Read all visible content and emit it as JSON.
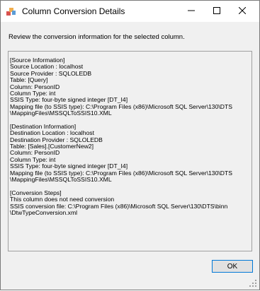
{
  "window": {
    "title": "Column Conversion Details",
    "controls": {
      "minimize_icon": "minimize-icon",
      "maximize_icon": "maximize-icon",
      "close_icon": "close-icon"
    }
  },
  "instruction": "Review the conversion information for the selected column.",
  "details": {
    "lines": [
      "[Source Information]",
      "Source Location : localhost",
      "Source Provider : SQLOLEDB",
      "Table: [Query]",
      "Column: PersonID",
      "Column Type: int",
      "SSIS Type: four-byte signed integer [DT_I4]",
      "Mapping file (to SSIS type): C:\\Program Files (x86)\\Microsoft SQL Server\\130\\DTS",
      "\\MappingFiles\\MSSQLToSSIS10.XML",
      "",
      "[Destination Information]",
      "Destination Location : localhost",
      "Destination Provider : SQLOLEDB",
      "Table: [Sales].[CustomerNew2]",
      "Column: PersonID",
      "Column Type: int",
      "SSIS Type: four-byte signed integer [DT_I4]",
      "Mapping file (to SSIS type): C:\\Program Files (x86)\\Microsoft SQL Server\\130\\DTS",
      "\\MappingFiles\\MSSQLToSSIS10.XML",
      "",
      "[Conversion Steps]",
      "This column does not need conversion",
      "SSIS conversion file: C:\\Program Files (x86)\\Microsoft SQL Server\\130\\DTS\\binn",
      "\\DtwTypeConversion.xml"
    ]
  },
  "buttons": {
    "ok_label": "OK"
  },
  "colors": {
    "window_bg": "#f0f0f0",
    "titlebar_bg": "#ffffff",
    "button_focus_border": "#0078d7"
  }
}
